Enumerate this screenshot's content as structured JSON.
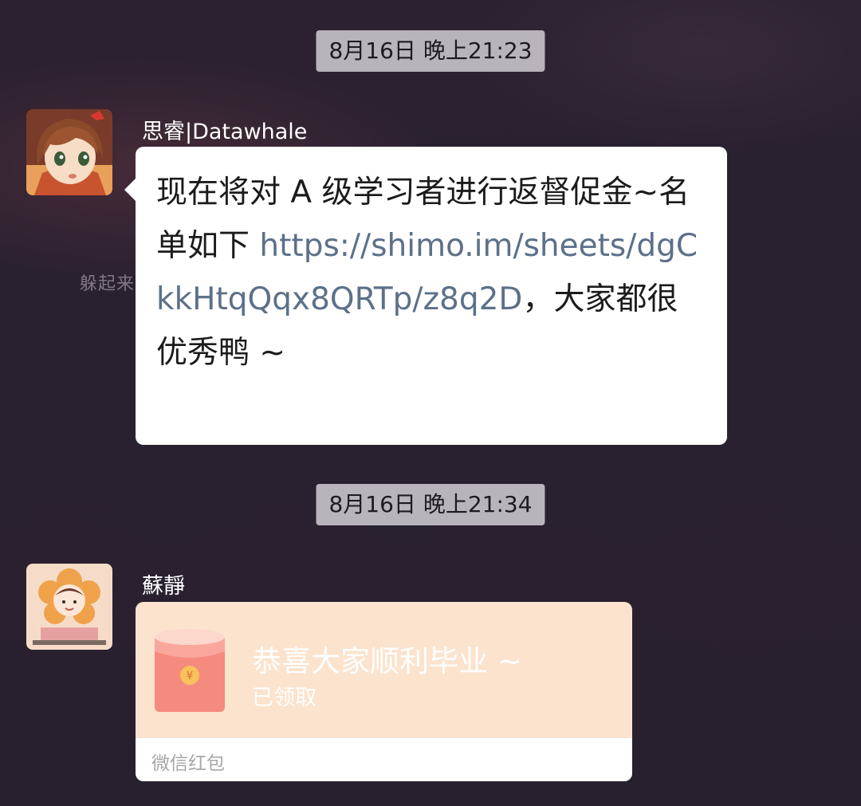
{
  "background": {
    "ghost_text": "躲起来"
  },
  "messages": [
    {
      "timestamp": "8月16日 晚上21:23",
      "sender": "思睿|Datawhale",
      "text_before_link": "现在将对 A 级学习者进行返督促金~名单如下 ",
      "link": "https://shimo.im/sheets/dgCkkHtqQqx8QRTp/z8q2D",
      "text_after_link": "，大家都很优秀鸭 ~"
    },
    {
      "timestamp": "8月16日 晚上21:34",
      "sender": "蘇靜",
      "red_packet": {
        "title": "恭喜大家顺利毕业 ~",
        "status": "已领取",
        "footer": "微信红包"
      }
    }
  ],
  "colors": {
    "background": "#2a2130",
    "timestamp_bg": "#b9b3bb",
    "bubble_bg": "#ffffff",
    "link": "#5c7089",
    "red_packet_bg": "#fbe3cd",
    "red_packet_icon": "#f2837a"
  },
  "icons": {
    "avatar_1": "anime-girl-avatar-icon",
    "avatar_2": "flower-girl-avatar-icon",
    "red_packet": "red-envelope-icon"
  }
}
